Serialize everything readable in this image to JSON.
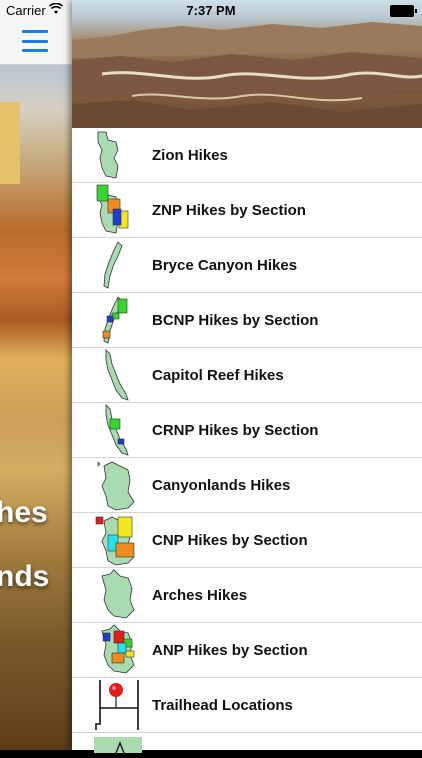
{
  "status_bar": {
    "carrier": "Carrier",
    "time": "7:37 PM"
  },
  "background_app": {
    "word_1": "hes",
    "word_2": "nds"
  },
  "menu": {
    "items": [
      {
        "label": "Zion Hikes",
        "icon": "zion-map-icon"
      },
      {
        "label": "ZNP Hikes by Section",
        "icon": "zion-sections-map-icon"
      },
      {
        "label": "Bryce Canyon Hikes",
        "icon": "bryce-map-icon"
      },
      {
        "label": "BCNP Hikes by Section",
        "icon": "bryce-sections-map-icon"
      },
      {
        "label": "Capitol Reef Hikes",
        "icon": "capitol-reef-map-icon"
      },
      {
        "label": "CRNP Hikes by Section",
        "icon": "capitol-reef-sections-map-icon"
      },
      {
        "label": "Canyonlands Hikes",
        "icon": "canyonlands-map-icon"
      },
      {
        "label": "CNP Hikes by Section",
        "icon": "canyonlands-sections-map-icon"
      },
      {
        "label": "Arches Hikes",
        "icon": "arches-map-icon"
      },
      {
        "label": "ANP Hikes by Section",
        "icon": "arches-sections-map-icon"
      },
      {
        "label": "Trailhead Locations",
        "icon": "trailhead-pin-icon"
      }
    ]
  },
  "colors": {
    "accent": "#1a7cf2",
    "park_fill": "#a8dbb0",
    "section_green": "#37d62c",
    "section_blue": "#1d3bd6",
    "section_orange": "#ef8a1e",
    "section_yellow": "#f4e61a",
    "section_cyan": "#23e3f0",
    "section_red": "#e31b1b"
  }
}
